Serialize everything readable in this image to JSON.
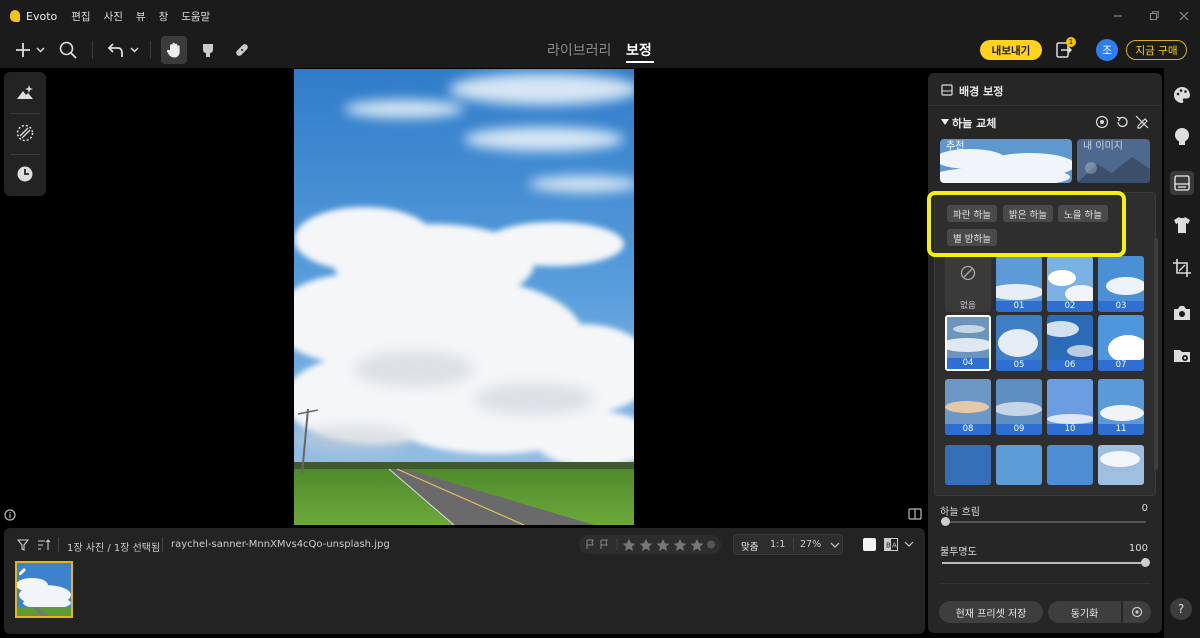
{
  "app": {
    "name": "Evoto",
    "menu": [
      "편집",
      "사진",
      "뷰",
      "창",
      "도움말"
    ]
  },
  "tabs": {
    "library": "라이브러리",
    "edit": "보정"
  },
  "header": {
    "export": "내보내기",
    "queue_badge": "1",
    "avatar": "조",
    "buy": "지금 구매"
  },
  "panel": {
    "title": "배경 보정",
    "section": "하늘 교체",
    "top_thumb_labels": [
      "추천",
      "내 이미지"
    ],
    "categories": [
      "파란 하늘",
      "밝은 하늘",
      "노을 하늘",
      "별 밤하늘"
    ],
    "none_label": "없음",
    "presets": [
      "01",
      "02",
      "03",
      "04",
      "05",
      "06",
      "07",
      "08",
      "09",
      "10",
      "11"
    ],
    "sliders": [
      {
        "label": "하늘 흐림",
        "value": "0",
        "fraction": 0
      },
      {
        "label": "불투명도",
        "value": "100",
        "fraction": 1
      }
    ],
    "save_preset": "현재 프리셋 저장",
    "sync": "동기화"
  },
  "filmstrip": {
    "count": "1장 사진 / 1장 선택됨",
    "filename": "raychel-sanner-MnnXMvs4cQo-unsplash.jpg",
    "fit": "맞춤",
    "one_to_one": "1:1",
    "zoom": "27%"
  },
  "colors": {
    "accent": "#ffd21e",
    "highlight": "#f4f10a",
    "preset_label": "#2e6fd1",
    "avatar": "#2d7ff0"
  }
}
